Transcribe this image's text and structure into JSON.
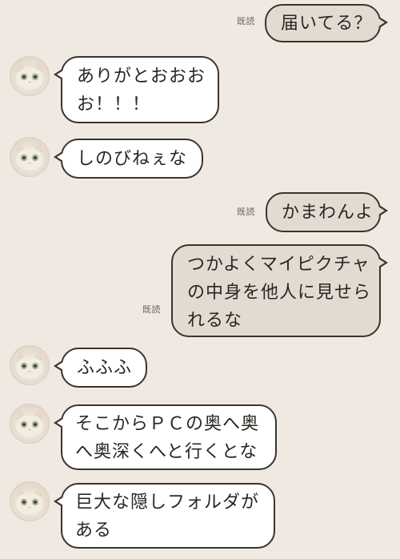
{
  "colors": {
    "background": "#efe9e1",
    "incoming_bubble": "#ffffff",
    "outgoing_bubble": "#e2dbd2",
    "bubble_border": "#3a342e"
  },
  "contact": {
    "avatar_icon": "cat-avatar-icon"
  },
  "messages": [
    {
      "direction": "outgoing",
      "read": "既読",
      "lines": [
        "届いてる？"
      ]
    },
    {
      "direction": "incoming",
      "lines": [
        "ありがとおおお",
        "お！！！"
      ]
    },
    {
      "direction": "incoming",
      "lines": [
        "しのびねぇな"
      ]
    },
    {
      "direction": "outgoing",
      "read": "既読",
      "lines": [
        "かまわんよ"
      ]
    },
    {
      "direction": "outgoing",
      "read": "既読",
      "lines": [
        "つかよくマイピクチャ",
        "の中身を他人に見せら",
        "れるな"
      ]
    },
    {
      "direction": "incoming",
      "lines": [
        "ふふふ"
      ]
    },
    {
      "direction": "incoming",
      "lines": [
        "そこからＰＣの奥へ奥",
        "へ奥深くへと行くとな"
      ]
    },
    {
      "direction": "incoming",
      "lines": [
        "巨大な隠しフォルダが",
        "ある"
      ]
    }
  ]
}
